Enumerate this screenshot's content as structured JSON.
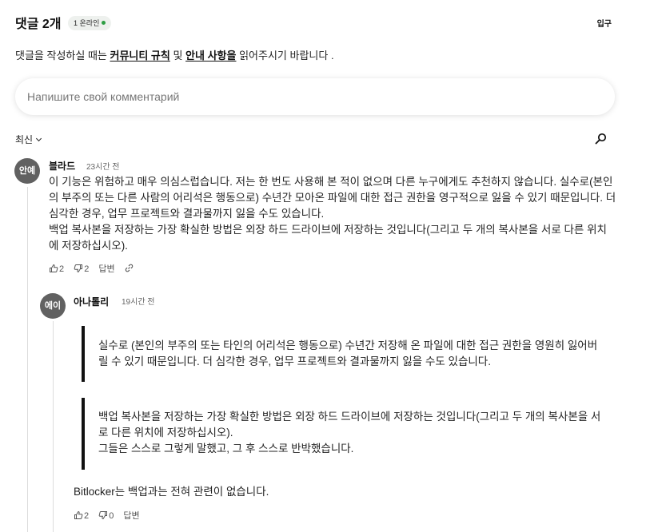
{
  "header": {
    "title": "댓글 2개",
    "online_badge": "1 온라인",
    "online_dot_color": "#2e9e44",
    "login_label": "입구"
  },
  "notice": {
    "prefix": "댓글을 작성하실 때는 ",
    "link1": "커뮤니티 규칙",
    "middle": " 및 ",
    "link2": "안내 사항을",
    "suffix": " 읽어주시기 바랍니다 ."
  },
  "comment_input": {
    "placeholder": "Напишите свой комментарий"
  },
  "toolbar": {
    "sort_label": "최신",
    "search_icon": "search-icon"
  },
  "comments": [
    {
      "avatar": "안예",
      "author": "블라드",
      "time": "23시간 전",
      "text": "이 기능은 위험하고 매우 의심스럽습니다. 저는 한 번도 사용해 본 적이 없으며 다른 누구에게도 추천하지 않습니다. 실수로(본인의 부주의 또는 다른 사람의 어리석은 행동으로) 수년간 모아온 파일에 대한 접근 권한을 영구적으로 잃을 수 있기 때문입니다. 더 심각한 경우, 업무 프로젝트와 결과물까지 잃을 수도 있습니다.\n백업 복사본을 저장하는 가장 확실한 방법은 외장 하드 드라이브에 저장하는 것입니다(그리고 두 개의 복사본을 서로 다른 위치에 저장하십시오).",
      "likes": "2",
      "dislikes": "2",
      "reply_label": "답변",
      "link_icon": "link-icon"
    },
    {
      "avatar": "에이",
      "author": "아나톨리",
      "time": "19시간 전",
      "quotes": [
        "실수로 (본인의 부주의 또는 타인의 어리석은 행동으로) 수년간 저장해 온 파일에 대한 접근 권한을 영원히 잃어버릴 수 있기 때문입니다. 더 심각한 경우, 업무 프로젝트와 결과물까지 잃을 수도 있습니다.",
        "백업 복사본을 저장하는 가장 확실한 방법은 외장 하드 드라이브에 저장하는 것입니다(그리고 두 개의 복사본을 서로 다른 위치에 저장하십시오).\n그들은 스스로 그렇게 말했고, 그 후 스스로 반박했습니다."
      ],
      "text": "Bitlocker는 백업과는 전혀 관련이 없습니다.",
      "likes": "2",
      "dislikes": "0",
      "reply_label": "답변"
    }
  ]
}
